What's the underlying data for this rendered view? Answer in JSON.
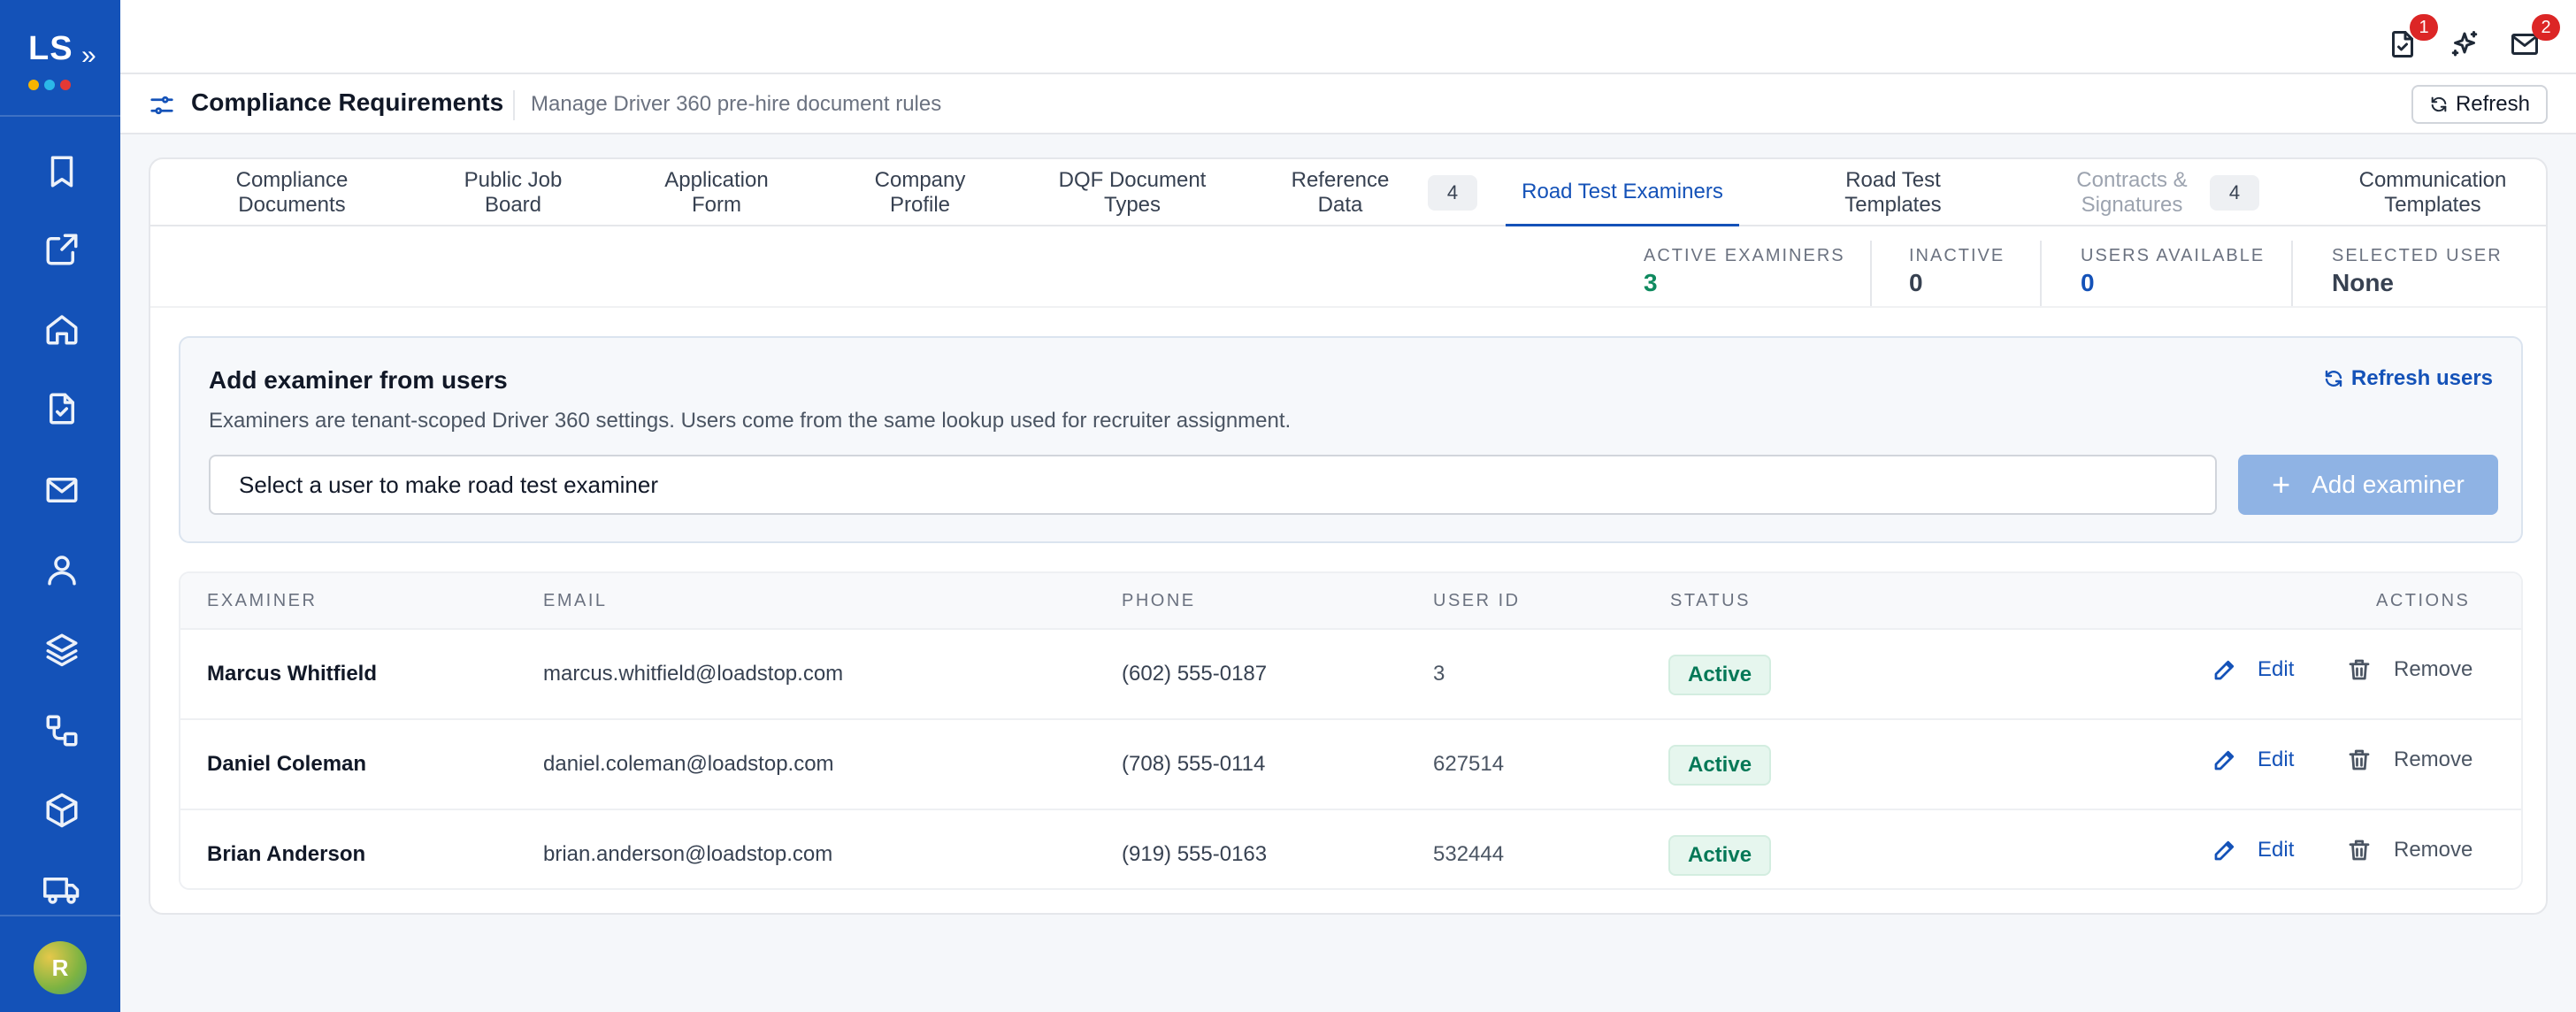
{
  "app": {
    "logo_text": "LS",
    "logo_dot_colors": [
      "#f5b400",
      "#2bb8e8",
      "#e53935"
    ],
    "brand_color": "#1452b8",
    "user_initial": "R"
  },
  "sidebar": {
    "items": [
      {
        "icon": "bookmark-icon"
      },
      {
        "icon": "external-link-icon"
      },
      {
        "icon": "home-icon"
      },
      {
        "icon": "document-check-icon"
      },
      {
        "icon": "mail-icon"
      },
      {
        "icon": "user-icon"
      },
      {
        "icon": "layers-icon"
      },
      {
        "icon": "workflow-icon"
      },
      {
        "icon": "package-icon"
      },
      {
        "icon": "truck-icon"
      }
    ]
  },
  "topbar": {
    "tasks_badge": "1",
    "messages_badge": "2"
  },
  "header": {
    "title": "Compliance Requirements",
    "subtitle": "Manage Driver 360 pre-hire document rules",
    "refresh_label": "Refresh"
  },
  "tabs": [
    {
      "label": "Compliance Documents",
      "state": "normal"
    },
    {
      "label": "Public Job Board",
      "state": "normal"
    },
    {
      "label": "Application Form",
      "state": "normal"
    },
    {
      "label": "Company Profile",
      "state": "normal"
    },
    {
      "label": "DQF Document Types",
      "state": "normal"
    },
    {
      "label": "Reference Data",
      "state": "normal",
      "count": "4"
    },
    {
      "label": "Road Test Examiners",
      "state": "active"
    },
    {
      "label": "Road Test Templates",
      "state": "normal"
    },
    {
      "label": "Contracts & Signatures",
      "state": "disabled",
      "count": "4"
    },
    {
      "label": "Communication Templates",
      "state": "normal"
    }
  ],
  "stats": [
    {
      "label": "ACTIVE EXAMINERS",
      "value": "3",
      "color": "#0f8a5f"
    },
    {
      "label": "INACTIVE",
      "value": "0",
      "color": "#374151"
    },
    {
      "label": "USERS AVAILABLE",
      "value": "0",
      "color": "#1452b8"
    },
    {
      "label": "SELECTED USER",
      "value": "None",
      "color": "#374151"
    }
  ],
  "add_panel": {
    "title": "Add examiner from users",
    "description": "Examiners are tenant-scoped Driver 360 settings. Users come from the same lookup used for recruiter assignment.",
    "refresh_users_label": "Refresh users",
    "select_placeholder": "Select a user to make road test examiner",
    "add_button_label": "Add examiner"
  },
  "table": {
    "columns": [
      "EXAMINER",
      "EMAIL",
      "PHONE",
      "USER ID",
      "STATUS",
      "ACTIONS"
    ],
    "rows": [
      {
        "name": "Marcus Whitfield",
        "email": "marcus.whitfield@loadstop.com",
        "phone": "(602) 555-0187",
        "user_id": "3",
        "status": "Active"
      },
      {
        "name": "Daniel Coleman",
        "email": "daniel.coleman@loadstop.com",
        "phone": "(708) 555-0114",
        "user_id": "627514",
        "status": "Active"
      },
      {
        "name": "Brian Anderson",
        "email": "brian.anderson@loadstop.com",
        "phone": "(919) 555-0163",
        "user_id": "532444",
        "status": "Active"
      }
    ],
    "edit_label": "Edit",
    "remove_label": "Remove"
  }
}
